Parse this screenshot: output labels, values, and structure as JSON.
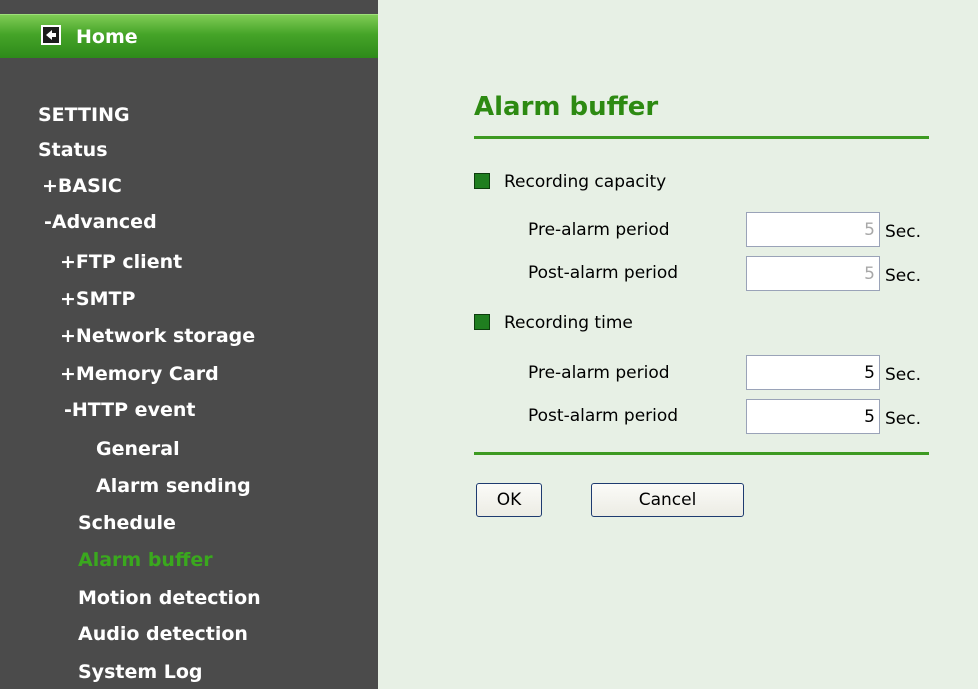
{
  "sidebar": {
    "home_label": "Home",
    "home_icon": "back-arrow-icon",
    "items": [
      {
        "label": "SETTING"
      },
      {
        "label": "Status"
      },
      {
        "label": "+BASIC"
      },
      {
        "label": "-Advanced"
      },
      {
        "label": "+FTP client"
      },
      {
        "label": "+SMTP"
      },
      {
        "label": "+Network storage"
      },
      {
        "label": "+Memory Card"
      },
      {
        "label": "-HTTP event"
      },
      {
        "label": "General"
      },
      {
        "label": "Alarm sending"
      },
      {
        "label": "Schedule"
      },
      {
        "label": "Alarm buffer",
        "active": true
      },
      {
        "label": "Motion detection"
      },
      {
        "label": "Audio detection"
      },
      {
        "label": "System Log"
      }
    ],
    "colors": {
      "background": "#4b4b4b",
      "active": "#3aa81e",
      "home_bar": "#45a428"
    }
  },
  "main": {
    "title": "Alarm buffer",
    "recording_capacity": {
      "label": "Recording capacity",
      "enabled": false,
      "pre_alarm": {
        "label": "Pre-alarm period",
        "value": "5",
        "unit": "Sec."
      },
      "post_alarm": {
        "label": "Post-alarm period",
        "value": "5",
        "unit": "Sec."
      }
    },
    "recording_time": {
      "label": "Recording time",
      "enabled": true,
      "pre_alarm": {
        "label": "Pre-alarm period",
        "value": "5",
        "unit": "Sec."
      },
      "post_alarm": {
        "label": "Post-alarm period",
        "value": "5",
        "unit": "Sec."
      }
    },
    "buttons": {
      "ok": "OK",
      "cancel": "Cancel"
    },
    "colors": {
      "background": "#e7f0e5",
      "title": "#2d8a12",
      "rule": "#3d9a21"
    }
  }
}
